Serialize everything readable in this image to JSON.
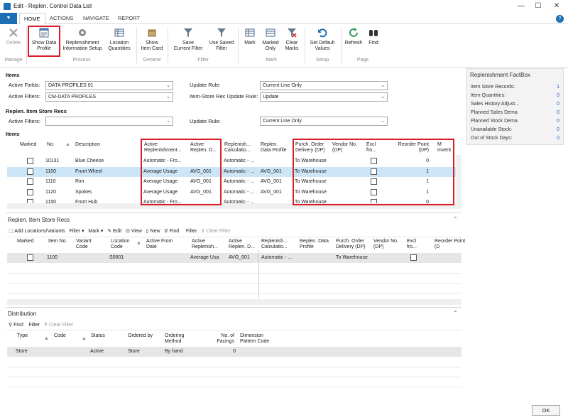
{
  "window": {
    "title": "Edit - Replen. Control Data List",
    "minimize": "—",
    "maximize": "☐",
    "close": "✕"
  },
  "tabs": [
    "HOME",
    "ACTIONS",
    "NAVIGATE",
    "REPORT"
  ],
  "ribbon": {
    "delete": "Delete",
    "show_data_profile_1": "Show Data",
    "show_data_profile_2": "Profile",
    "replen_info_1": "Replenishment",
    "replen_info_2": "Information Setup",
    "location_q_1": "Location",
    "location_q_2": "Quantities",
    "show_item_card_1": "Show",
    "show_item_card_2": "Item Card",
    "save_filter_1": "Save",
    "save_filter_2": "Current Filter",
    "use_saved_1": "Use Saved",
    "use_saved_2": "Filter",
    "mark": "Mark",
    "marked_only_1": "Marked",
    "marked_only_2": "Only",
    "clear_marks_1": "Clear",
    "clear_marks_2": "Marks",
    "set_default_1": "Set Default",
    "set_default_2": "Values",
    "refresh": "Refresh",
    "find": "Find",
    "groups": {
      "manage": "Manage",
      "process": "Process",
      "general": "General",
      "filter": "Filter",
      "mark": "Mark",
      "setup": "Setup",
      "page": "Page"
    }
  },
  "items_section": {
    "title": "Items",
    "active_fields_label": "Active Fields:",
    "active_fields_value": "DATA PROFILES 01",
    "active_filters_label": "Active Filters:",
    "active_filters_value": "CM-DATA PROFILES",
    "update_rule_label": "Update Rule:",
    "update_rule_value": "Current Line Only",
    "item_store_rule_label": "Item-Store Rec Update Rule:",
    "item_store_rule_value": "Update"
  },
  "replen_section": {
    "title": "Replen. Item Store Recs",
    "active_filters_label": "Active Filters:",
    "active_filters_value": "",
    "update_rule_label": "Update Rule:",
    "update_rule_value": "Current Line Only"
  },
  "items_grid": {
    "title": "Items",
    "headers": {
      "marked": "Marked",
      "no": "No.",
      "description": "Description",
      "active_replen_method_1": "Active",
      "active_replen_method_2": "Replenishment...",
      "active_replen_d_1": "Active",
      "active_replen_d_2": "Replen. D...",
      "replen_calc_1": "Replenish...",
      "replen_calc_2": "Calculatio...",
      "replen_data_profile_1": "Replen.",
      "replen_data_profile_2": "Data Profile",
      "purch_order_1": "Purch. Order",
      "purch_order_2": "Delivery (DP)",
      "vendor_no_1": "Vendor No.",
      "vendor_no_2": "(DP)",
      "excl_1": "Excl",
      "excl_2": "fro...",
      "reorder_1": "Reorder Point",
      "reorder_2": "(DP)",
      "m_1": "M",
      "m_2": "Invent"
    },
    "rows": [
      {
        "no": "10131",
        "description": "Blue Cheese",
        "method": "Automatic - Fro...",
        "replen_d": "",
        "calc": "Automatic - ...",
        "profile": "",
        "delivery": "To Warehouse",
        "vendor": "",
        "reorder": "0"
      },
      {
        "no": "1100",
        "description": "Front Wheel",
        "method": "Average Usage",
        "replen_d": "AVG_001",
        "calc": "Automatic - ...",
        "profile": "AVG_001",
        "delivery": "To Warehouse",
        "vendor": "",
        "reorder": "1"
      },
      {
        "no": "1110",
        "description": "Rim",
        "method": "Average Usage",
        "replen_d": "AVG_001",
        "calc": "Automatic - ...",
        "profile": "AVG_001",
        "delivery": "To Warehouse",
        "vendor": "",
        "reorder": "1"
      },
      {
        "no": "1120",
        "description": "Spokes",
        "method": "Average Usage",
        "replen_d": "AVG_001",
        "calc": "Automatic - ...",
        "profile": "AVG_001",
        "delivery": "To Warehouse",
        "vendor": "",
        "reorder": "1"
      },
      {
        "no": "1150",
        "description": "Front Hub",
        "method": "Automatic - Fro...",
        "replen_d": "",
        "calc": "Automatic - ...",
        "profile": "",
        "delivery": "To Warehouse",
        "vendor": "",
        "reorder": "0"
      }
    ]
  },
  "store_recs": {
    "title": "Replen. Item Store Recs",
    "toolbar": {
      "add": "Add Locations/Variants",
      "filter": "Filter",
      "mark": "Mark",
      "edit": "Edit",
      "view": "View",
      "new": "New",
      "find": "Find",
      "filter2": "Filter",
      "clear_filter": "Clear Filter"
    },
    "headers": {
      "marked": "Marked",
      "item_no": "Item No.",
      "variant_1": "Variant",
      "variant_2": "Code",
      "location_1": "Location",
      "location_2": "Code",
      "from_1": "Active From",
      "from_2": "Date",
      "method_1": "Active",
      "method_2": "Replenish...",
      "replen_d_1": "Active",
      "replen_d_2": "Replen. D...",
      "calc_1": "Replenish...",
      "calc_2": "Calculatio...",
      "profile_1": "Replen. Data",
      "profile_2": "Profile",
      "delivery_1": "Purch. Order",
      "delivery_2": "Delivery (DP)",
      "vendor_1": "Vendor No.",
      "vendor_2": "(DP)",
      "excl_1": "Excl",
      "excl_2": "fro...",
      "reorder_1": "Reorder Point",
      "reorder_2": "(D"
    },
    "row": {
      "item_no": "1100",
      "variant": "",
      "location": "S0001",
      "from": "",
      "method": "Average Usa",
      "replen_d": "AVG_001",
      "calc": "Automatic - ...",
      "profile": "",
      "delivery": "To Warehouse"
    }
  },
  "distribution": {
    "title": "Distribution",
    "toolbar": {
      "find": "Find",
      "filter": "Filter",
      "clear_filter": "Clear Filter"
    },
    "headers": {
      "type": "Type",
      "code": "Code",
      "status": "Status",
      "ordered_by": "Ordered by",
      "ordering_1": "Ordering",
      "ordering_2": "Method",
      "facings_1": "No. of",
      "facings_2": "Facings",
      "pattern_1": "Dimension",
      "pattern_2": "Pattern Code"
    },
    "row": {
      "type": "Store",
      "code": "",
      "status": "Active",
      "ordered_by": "Store",
      "ordering": "By hand",
      "facings": "0",
      "pattern": ""
    }
  },
  "factbox": {
    "title": "Replenishment FactBox",
    "rows": [
      {
        "label": "Item Store Records:",
        "value": "1"
      },
      {
        "label": "Item Quantities:",
        "value": "0"
      },
      {
        "label": "Sales History Adjust...",
        "value": "0"
      },
      {
        "label": "Planned Sales Dema",
        "value": "0"
      },
      {
        "label": "Planned Stock Dema",
        "value": "0"
      },
      {
        "label": "Unavailable Stock:",
        "value": "0"
      },
      {
        "label": "Out of Stock Days:",
        "value": "0"
      }
    ]
  },
  "ok_button": "OK",
  "colors": {
    "accent": "#1d6fb5",
    "highlight_box": "#d81e27",
    "selected_row": "#cde6f7"
  }
}
